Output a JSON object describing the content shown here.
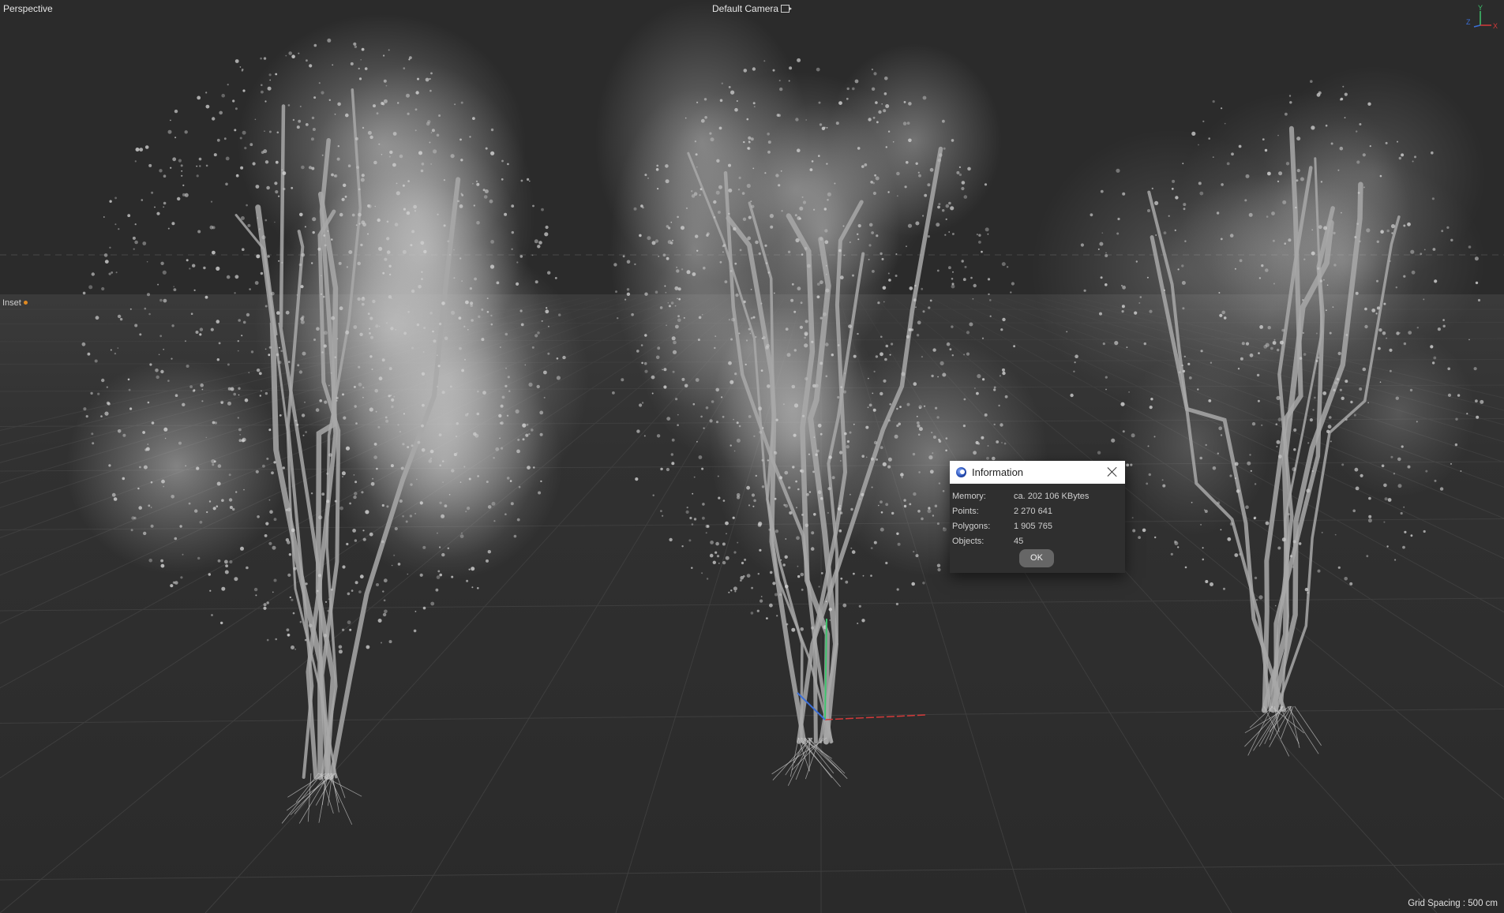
{
  "viewport": {
    "view_name": "Perspective",
    "camera_name": "Default Camera",
    "camera_icon": "camera-icon",
    "inset_label": "Inset",
    "grid_spacing": "Grid Spacing : 500 cm",
    "axis_labels": {
      "x": "X",
      "y": "Y",
      "z": "Z"
    },
    "colors": {
      "background": "#2b2b2b",
      "x_axis": "#d43a3a",
      "y_axis": "#3ec46d",
      "z_axis": "#3b6fd8"
    }
  },
  "info_dialog": {
    "title": "Information",
    "app_icon": "cinema4d-icon",
    "close_icon": "close-icon",
    "rows": [
      {
        "label": "Memory:",
        "value": "ca. 202 106 KBytes"
      },
      {
        "label": "Points:",
        "value": "2 270 641"
      },
      {
        "label": "Polygons:",
        "value": "1 905 765"
      },
      {
        "label": "Objects:",
        "value": "45"
      }
    ],
    "ok_label": "OK"
  }
}
